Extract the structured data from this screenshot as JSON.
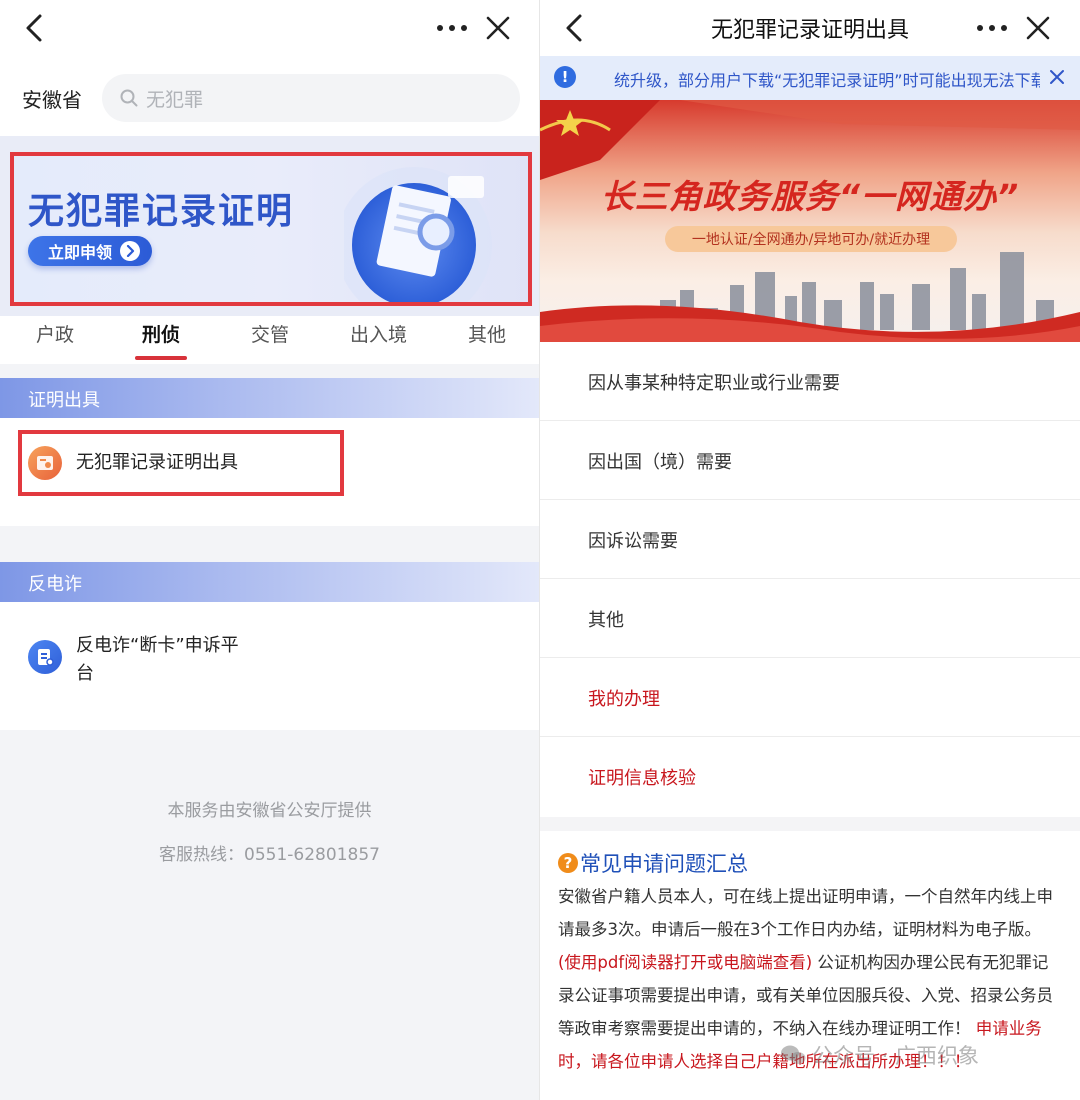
{
  "left": {
    "province": "安徽省",
    "search_placeholder": "无犯罪",
    "banner": {
      "title": "无犯罪记录证明",
      "button": "立即申领"
    },
    "tabs": [
      "户政",
      "刑侦",
      "交管",
      "出入境",
      "其他"
    ],
    "active_tab": "刑侦",
    "sections": [
      {
        "title": "证明出具",
        "items": [
          {
            "label": "无犯罪记录证明出具",
            "icon": "certificate-icon"
          }
        ]
      },
      {
        "title": "反电诈",
        "items": [
          {
            "label_line1": "反电诈“断卡”申诉平",
            "label_line2": "台",
            "icon": "document-icon"
          }
        ]
      }
    ],
    "footer": {
      "provider": "本服务由安徽省公安厅提供",
      "hotline": "客服热线：0551-62801857"
    }
  },
  "right": {
    "title": "无犯罪记录证明出具",
    "notice": "统升级，部分用户下载“无犯罪记录证明”时可能出现无法下载",
    "hero": {
      "title": "长三角政务服务“一网通办”",
      "subtitle": "一地认证/全网通办/异地可办/就近办理"
    },
    "menu": [
      {
        "label": "因从事某种特定职业或行业需要",
        "style": "normal"
      },
      {
        "label": "因出国（境）需要",
        "style": "normal"
      },
      {
        "label": "因诉讼需要",
        "style": "normal"
      },
      {
        "label": "其他",
        "style": "normal"
      },
      {
        "label": "我的办理",
        "style": "red"
      },
      {
        "label": "证明信息核验",
        "style": "red"
      }
    ],
    "faq": {
      "title": "常见申请问题汇总",
      "p1": "安徽省户籍人员本人，可在线上提出证明申请，一个自然年内线上申请最多3次。申请后一般在3个工作日内办结，证明材料为电子版。",
      "p1_red": "(使用pdf阅读器打开或电脑端查看)",
      "p2": "公证机构因办理公民有无犯罪记录公证事项需要提出申请，或有关单位因服兵役、入党、招录公务员等政审考察需要提出申请的，不纳入在线办理证明工作！",
      "p2_red": "申请业务时，请各位申请人选择自己户籍地所在派出所办理！！！"
    },
    "watermark": "公众号 · 广西织象"
  },
  "colors": {
    "accent_red": "#e2393f",
    "link_red": "#c8171e",
    "primary_blue": "#2f56c8"
  }
}
